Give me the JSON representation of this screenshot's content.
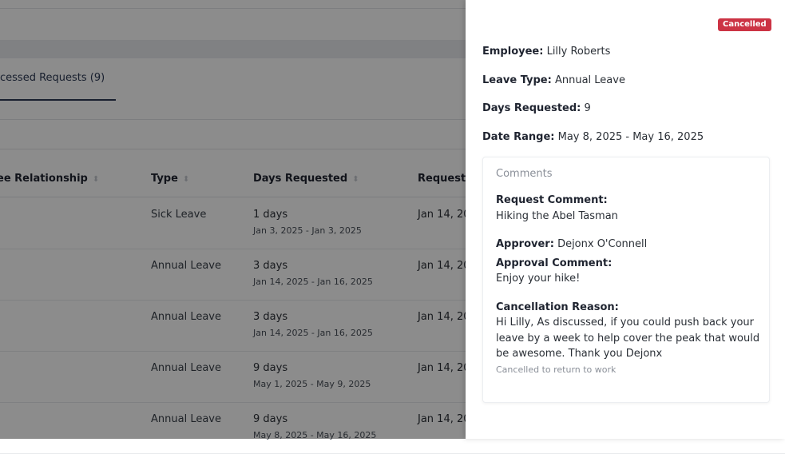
{
  "tab": {
    "label": "cessed Requests (9)"
  },
  "table": {
    "headers": {
      "relationship": "ee Relationship",
      "type": "Type",
      "days": "Days Requested",
      "requested": "Requeste"
    },
    "rows": [
      {
        "type": "Sick Leave",
        "days": "1 days",
        "range": "Jan 3, 2025 - Jan 3, 2025",
        "requested": "Jan 14, 20"
      },
      {
        "type": "Annual Leave",
        "days": "3 days",
        "range": "Jan 14, 2025 - Jan 16, 2025",
        "requested": "Jan 14, 20"
      },
      {
        "type": "Annual Leave",
        "days": "3 days",
        "range": "Jan 14, 2025 - Jan 16, 2025",
        "requested": "Jan 14, 20"
      },
      {
        "type": "Annual Leave",
        "days": "9 days",
        "range": "May 1, 2025 - May 9, 2025",
        "requested": "Jan 14, 20"
      },
      {
        "type": "Annual Leave",
        "days": "9 days",
        "range": "May 8, 2025 - May 16, 2025",
        "requested": "Jan 14, 20"
      }
    ]
  },
  "drawer": {
    "status_badge": "Cancelled",
    "status_color": "#cc3344",
    "employee_label": "Employee:",
    "employee_value": "Lilly Roberts",
    "leave_type_label": "Leave Type:",
    "leave_type_value": "Annual Leave",
    "days_label": "Days Requested:",
    "days_value": "9",
    "date_range_label": "Date Range:",
    "date_range_value": "May 8, 2025 - May 16, 2025",
    "comments": {
      "title": "Comments",
      "request_comment_label": "Request Comment:",
      "request_comment": "Hiking the Abel Tasman",
      "approver_label": "Approver:",
      "approver": "Dejonx O'Connell",
      "approval_comment_label": "Approval Comment:",
      "approval_comment": "Enjoy your hike!",
      "cancellation_reason_label": "Cancellation Reason:",
      "cancellation_reason": "Hi Lilly, As discussed, if you could push back your leave by a week to help cover the peak that would be awesome. Thank you Dejonx",
      "cancellation_note": "Cancelled to return to work"
    }
  }
}
